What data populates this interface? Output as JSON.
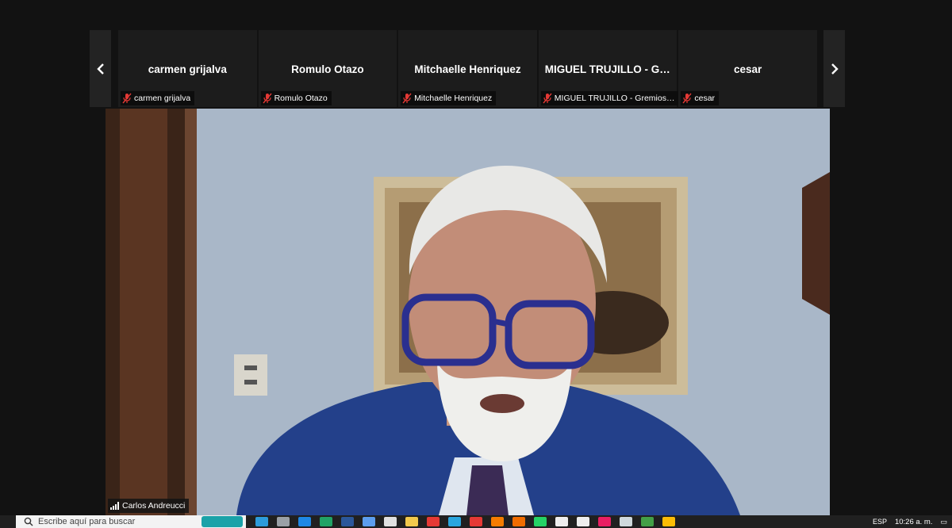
{
  "participants_strip": {
    "prev_label": "previous participants",
    "next_label": "next participants",
    "tiles": [
      {
        "display": "carmen grijalva",
        "tag": "carmen grijalva"
      },
      {
        "display": "Romulo Otazo",
        "tag": "Romulo Otazo"
      },
      {
        "display": "Mitchaelle Henriquez",
        "tag": "Mitchaelle Henriquez"
      },
      {
        "display": "MIGUEL TRUJILLO - Gre...",
        "tag": "MIGUEL TRUJILLO - Gremios Pá..."
      },
      {
        "display": "cesar",
        "tag": "cesar"
      }
    ]
  },
  "active_speaker": {
    "name": "Carlos Andreucci"
  },
  "taskbar": {
    "search_placeholder": "Escribe aquí para buscar",
    "language": "ESP",
    "time": "10:26 a. m.",
    "app_icons": [
      "cortana-icon",
      "task-view-icon",
      "edge-icon",
      "excel-icon",
      "word-icon",
      "notes-icon",
      "media-icon",
      "explorer-icon",
      "opera-icon",
      "telegram-icon",
      "app-red-icon",
      "vlc-icon",
      "paint-icon",
      "whatsapp-icon",
      "file-icon",
      "file-icon-2",
      "photos-icon",
      "docs-icon",
      "camtasia-icon",
      "chrome-icon"
    ],
    "app_colors": [
      "#2d9cdb",
      "#9aa0a6",
      "#1e88e5",
      "#21a366",
      "#2b579a",
      "#5c9ded",
      "#e0e0e0",
      "#f2c94c",
      "#e53935",
      "#2aa6de",
      "#e53935",
      "#f57c00",
      "#ef6c00",
      "#25d366",
      "#eeeeee",
      "#eeeeee",
      "#e91e63",
      "#cfd8dc",
      "#43a047",
      "#fbbc05"
    ]
  }
}
